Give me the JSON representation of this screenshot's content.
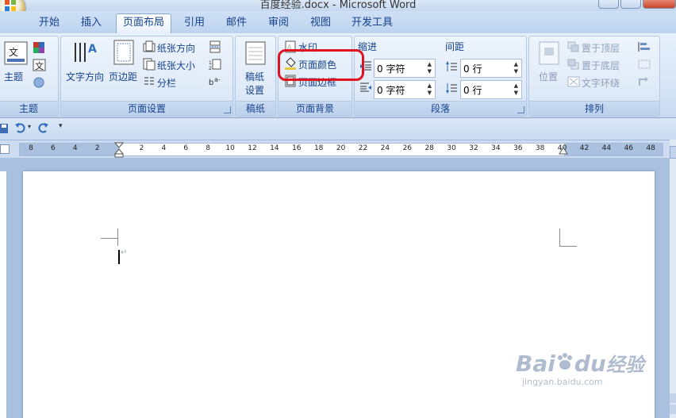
{
  "window": {
    "title": "百度经验.docx - Microsoft Word"
  },
  "tabs": [
    "开始",
    "插入",
    "页面布局",
    "引用",
    "邮件",
    "审阅",
    "视图",
    "开发工具"
  ],
  "active_tab": "页面布局",
  "ribbon": {
    "theme": {
      "label_line1": "主题",
      "group_label": "主题"
    },
    "page_setup": {
      "text_direction": "文字方向",
      "margins": "页边距",
      "orientation": "纸张方向",
      "size": "纸张大小",
      "columns": "分栏",
      "group_label": "页面设置"
    },
    "manuscript": {
      "label_line1": "稿纸",
      "label_line2": "设置",
      "group_label": "稿纸"
    },
    "page_background": {
      "watermark": "水印",
      "page_color": "页面颜色",
      "page_borders": "页面边框",
      "group_label": "页面背景"
    },
    "paragraph": {
      "indent_title": "缩进",
      "spacing_title": "间距",
      "indent_left": "0 字符",
      "indent_right": "0 字符",
      "spacing_before": "0 行",
      "spacing_after": "0 行",
      "group_label": "段落"
    },
    "arrange": {
      "position": "位置",
      "bring_front": "置于顶层",
      "send_back": "置于底层",
      "text_wrap": "文字环绕",
      "group_label": "排列"
    }
  },
  "ruler": {
    "numbers": [
      "8",
      "6",
      "4",
      "2",
      "2",
      "4",
      "6",
      "8",
      "10",
      "12",
      "14",
      "16",
      "18",
      "20",
      "22",
      "24",
      "26",
      "28",
      "30",
      "32",
      "34",
      "36",
      "38",
      "40",
      "42",
      "44",
      "46",
      "48"
    ]
  },
  "watermark": {
    "text1": "Bai",
    "text2": "du",
    "text3": "经验",
    "url": "jingyan.baidu.com"
  },
  "colors": {
    "ribbon_text": "#15428b",
    "highlight": "#e0121f",
    "page_bg": "#a9c1de"
  }
}
